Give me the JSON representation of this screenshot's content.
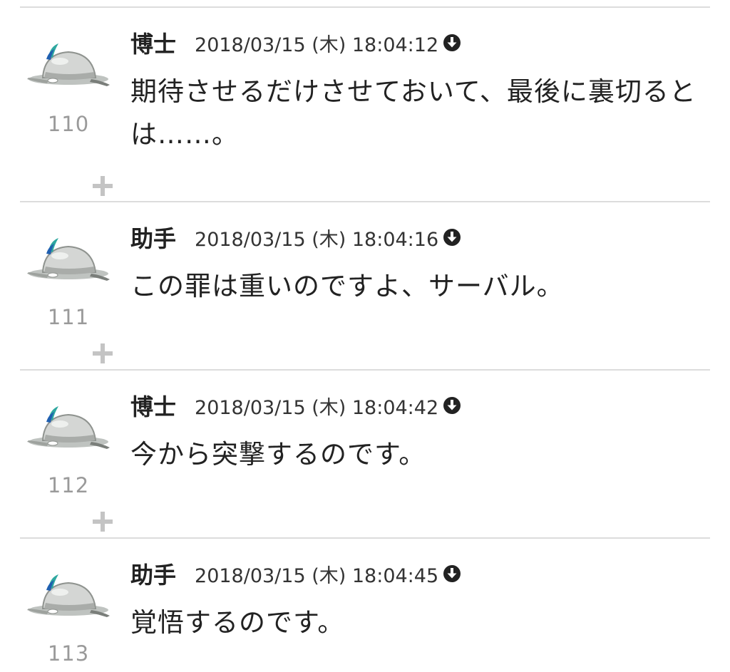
{
  "posts": [
    {
      "number": "110",
      "author": "博士",
      "timestamp": "2018/03/15 (木) 18:04:12",
      "body": "期待させるだけさせておいて、最後に裏切るとは……。"
    },
    {
      "number": "111",
      "author": "助手",
      "timestamp": "2018/03/15 (木) 18:04:16",
      "body": "この罪は重いのですよ、サーバル。"
    },
    {
      "number": "112",
      "author": "博士",
      "timestamp": "2018/03/15 (木) 18:04:42",
      "body": "今から突撃するのです。"
    },
    {
      "number": "113",
      "author": "助手",
      "timestamp": "2018/03/15 (木) 18:04:45",
      "body": "覚悟するのです。"
    }
  ],
  "icons": {
    "avatar": "helmet-avatar-icon",
    "download": "download-circle-icon",
    "plus": "plus-icon"
  },
  "colors": {
    "divider": "#dcdcdc",
    "number": "#9a9a9a",
    "plus": "#c4c4c4",
    "text": "#222222"
  }
}
